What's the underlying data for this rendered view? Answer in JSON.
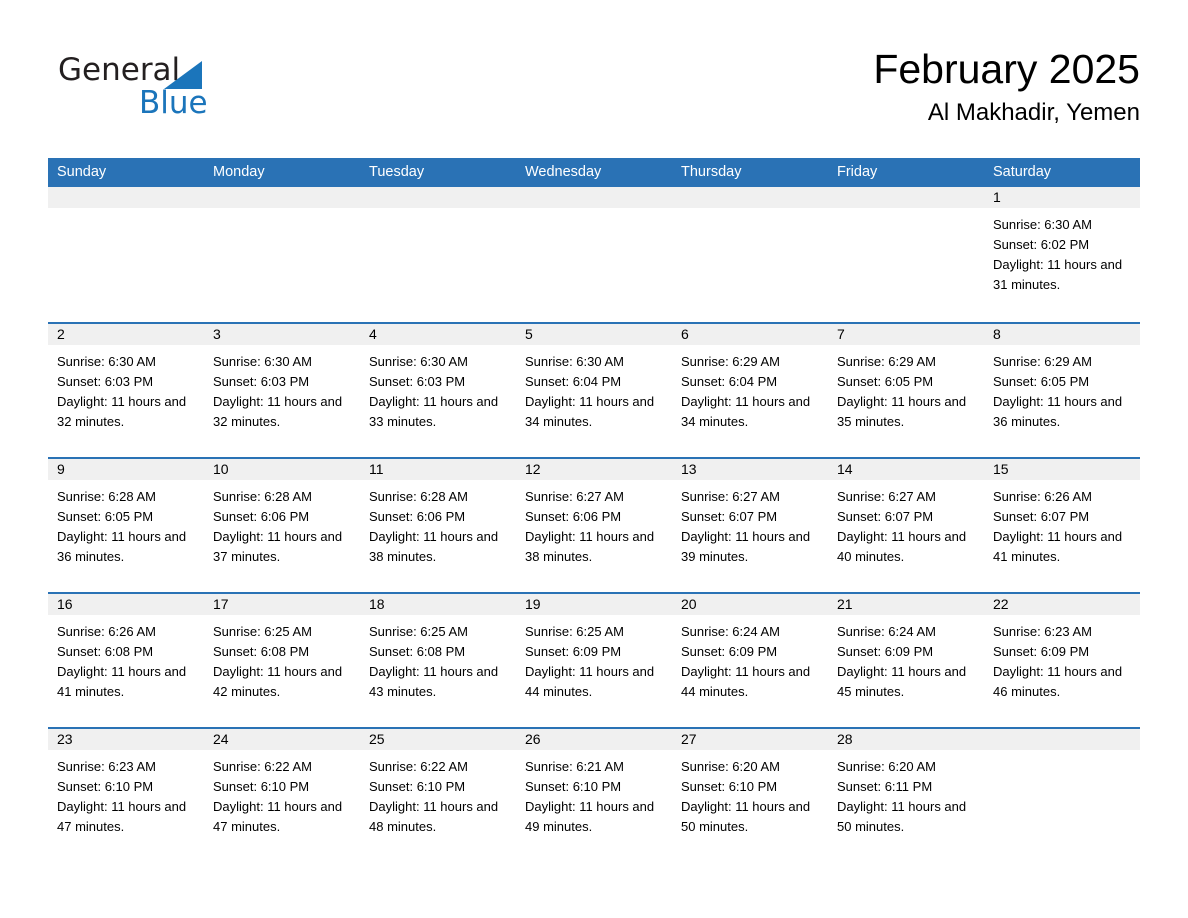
{
  "brand": {
    "word_one": "General",
    "word_two": "Blue",
    "accent_color": "#1b75bb"
  },
  "header": {
    "month_title": "February 2025",
    "location": "Al Makhadir, Yemen"
  },
  "theme": {
    "header_blue": "#2a72b5",
    "day_head_gray": "#f0f0f0"
  },
  "calendar": {
    "weekdays": [
      "Sunday",
      "Monday",
      "Tuesday",
      "Wednesday",
      "Thursday",
      "Friday",
      "Saturday"
    ],
    "weeks": [
      [
        {
          "day": "",
          "empty": true
        },
        {
          "day": "",
          "empty": true
        },
        {
          "day": "",
          "empty": true
        },
        {
          "day": "",
          "empty": true
        },
        {
          "day": "",
          "empty": true
        },
        {
          "day": "",
          "empty": true
        },
        {
          "day": "1",
          "sunrise": "Sunrise: 6:30 AM",
          "sunset": "Sunset: 6:02 PM",
          "daylight": "Daylight: 11 hours and 31 minutes."
        }
      ],
      [
        {
          "day": "2",
          "sunrise": "Sunrise: 6:30 AM",
          "sunset": "Sunset: 6:03 PM",
          "daylight": "Daylight: 11 hours and 32 minutes."
        },
        {
          "day": "3",
          "sunrise": "Sunrise: 6:30 AM",
          "sunset": "Sunset: 6:03 PM",
          "daylight": "Daylight: 11 hours and 32 minutes."
        },
        {
          "day": "4",
          "sunrise": "Sunrise: 6:30 AM",
          "sunset": "Sunset: 6:03 PM",
          "daylight": "Daylight: 11 hours and 33 minutes."
        },
        {
          "day": "5",
          "sunrise": "Sunrise: 6:30 AM",
          "sunset": "Sunset: 6:04 PM",
          "daylight": "Daylight: 11 hours and 34 minutes."
        },
        {
          "day": "6",
          "sunrise": "Sunrise: 6:29 AM",
          "sunset": "Sunset: 6:04 PM",
          "daylight": "Daylight: 11 hours and 34 minutes."
        },
        {
          "day": "7",
          "sunrise": "Sunrise: 6:29 AM",
          "sunset": "Sunset: 6:05 PM",
          "daylight": "Daylight: 11 hours and 35 minutes."
        },
        {
          "day": "8",
          "sunrise": "Sunrise: 6:29 AM",
          "sunset": "Sunset: 6:05 PM",
          "daylight": "Daylight: 11 hours and 36 minutes."
        }
      ],
      [
        {
          "day": "9",
          "sunrise": "Sunrise: 6:28 AM",
          "sunset": "Sunset: 6:05 PM",
          "daylight": "Daylight: 11 hours and 36 minutes."
        },
        {
          "day": "10",
          "sunrise": "Sunrise: 6:28 AM",
          "sunset": "Sunset: 6:06 PM",
          "daylight": "Daylight: 11 hours and 37 minutes."
        },
        {
          "day": "11",
          "sunrise": "Sunrise: 6:28 AM",
          "sunset": "Sunset: 6:06 PM",
          "daylight": "Daylight: 11 hours and 38 minutes."
        },
        {
          "day": "12",
          "sunrise": "Sunrise: 6:27 AM",
          "sunset": "Sunset: 6:06 PM",
          "daylight": "Daylight: 11 hours and 38 minutes."
        },
        {
          "day": "13",
          "sunrise": "Sunrise: 6:27 AM",
          "sunset": "Sunset: 6:07 PM",
          "daylight": "Daylight: 11 hours and 39 minutes."
        },
        {
          "day": "14",
          "sunrise": "Sunrise: 6:27 AM",
          "sunset": "Sunset: 6:07 PM",
          "daylight": "Daylight: 11 hours and 40 minutes."
        },
        {
          "day": "15",
          "sunrise": "Sunrise: 6:26 AM",
          "sunset": "Sunset: 6:07 PM",
          "daylight": "Daylight: 11 hours and 41 minutes."
        }
      ],
      [
        {
          "day": "16",
          "sunrise": "Sunrise: 6:26 AM",
          "sunset": "Sunset: 6:08 PM",
          "daylight": "Daylight: 11 hours and 41 minutes."
        },
        {
          "day": "17",
          "sunrise": "Sunrise: 6:25 AM",
          "sunset": "Sunset: 6:08 PM",
          "daylight": "Daylight: 11 hours and 42 minutes."
        },
        {
          "day": "18",
          "sunrise": "Sunrise: 6:25 AM",
          "sunset": "Sunset: 6:08 PM",
          "daylight": "Daylight: 11 hours and 43 minutes."
        },
        {
          "day": "19",
          "sunrise": "Sunrise: 6:25 AM",
          "sunset": "Sunset: 6:09 PM",
          "daylight": "Daylight: 11 hours and 44 minutes."
        },
        {
          "day": "20",
          "sunrise": "Sunrise: 6:24 AM",
          "sunset": "Sunset: 6:09 PM",
          "daylight": "Daylight: 11 hours and 44 minutes."
        },
        {
          "day": "21",
          "sunrise": "Sunrise: 6:24 AM",
          "sunset": "Sunset: 6:09 PM",
          "daylight": "Daylight: 11 hours and 45 minutes."
        },
        {
          "day": "22",
          "sunrise": "Sunrise: 6:23 AM",
          "sunset": "Sunset: 6:09 PM",
          "daylight": "Daylight: 11 hours and 46 minutes."
        }
      ],
      [
        {
          "day": "23",
          "sunrise": "Sunrise: 6:23 AM",
          "sunset": "Sunset: 6:10 PM",
          "daylight": "Daylight: 11 hours and 47 minutes."
        },
        {
          "day": "24",
          "sunrise": "Sunrise: 6:22 AM",
          "sunset": "Sunset: 6:10 PM",
          "daylight": "Daylight: 11 hours and 47 minutes."
        },
        {
          "day": "25",
          "sunrise": "Sunrise: 6:22 AM",
          "sunset": "Sunset: 6:10 PM",
          "daylight": "Daylight: 11 hours and 48 minutes."
        },
        {
          "day": "26",
          "sunrise": "Sunrise: 6:21 AM",
          "sunset": "Sunset: 6:10 PM",
          "daylight": "Daylight: 11 hours and 49 minutes."
        },
        {
          "day": "27",
          "sunrise": "Sunrise: 6:20 AM",
          "sunset": "Sunset: 6:10 PM",
          "daylight": "Daylight: 11 hours and 50 minutes."
        },
        {
          "day": "28",
          "sunrise": "Sunrise: 6:20 AM",
          "sunset": "Sunset: 6:11 PM",
          "daylight": "Daylight: 11 hours and 50 minutes."
        },
        {
          "day": "",
          "empty": true
        }
      ]
    ]
  }
}
